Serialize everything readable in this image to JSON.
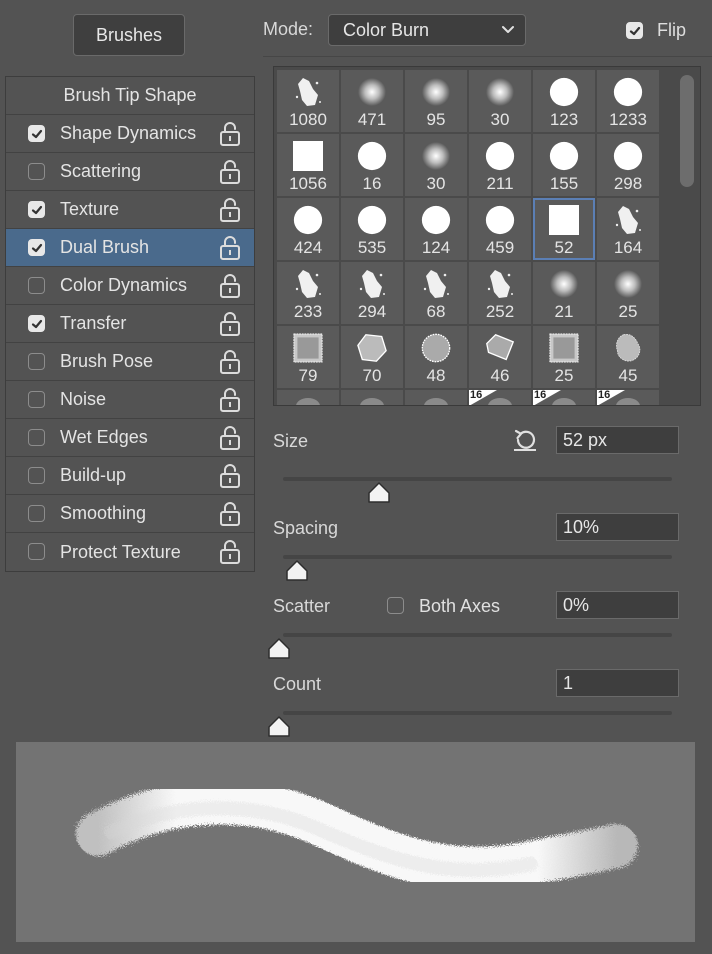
{
  "brushes_button": "Brushes",
  "mode": {
    "label": "Mode:",
    "value": "Color Burn"
  },
  "flip": {
    "label": "Flip",
    "checked": true
  },
  "left_panel": {
    "header": "Brush Tip Shape",
    "items": [
      {
        "label": "Shape Dynamics",
        "checked": true
      },
      {
        "label": "Scattering",
        "checked": false
      },
      {
        "label": "Texture",
        "checked": true
      },
      {
        "label": "Dual Brush",
        "checked": true,
        "selected": true
      },
      {
        "label": "Color Dynamics",
        "checked": false
      },
      {
        "label": "Transfer",
        "checked": true
      },
      {
        "label": "Brush Pose",
        "checked": false
      },
      {
        "label": "Noise",
        "checked": false
      },
      {
        "label": "Wet Edges",
        "checked": false
      },
      {
        "label": "Build-up",
        "checked": false
      },
      {
        "label": "Smoothing",
        "checked": false
      },
      {
        "label": "Protect Texture",
        "checked": false
      }
    ]
  },
  "brush_grid": {
    "selected": "52",
    "cells": [
      {
        "num": "1080",
        "shape": "splatter"
      },
      {
        "num": "471",
        "shape": "soft-circle"
      },
      {
        "num": "95",
        "shape": "soft-circle"
      },
      {
        "num": "30",
        "shape": "soft-circle"
      },
      {
        "num": "123",
        "shape": "hard-circle"
      },
      {
        "num": "1233",
        "shape": "hard-circle"
      },
      {
        "num": "1056",
        "shape": "square"
      },
      {
        "num": "16",
        "shape": "hard-circle"
      },
      {
        "num": "30",
        "shape": "soft-circle"
      },
      {
        "num": "211",
        "shape": "hard-circle"
      },
      {
        "num": "155",
        "shape": "hard-circle"
      },
      {
        "num": "298",
        "shape": "hard-circle"
      },
      {
        "num": "424",
        "shape": "hard-circle"
      },
      {
        "num": "535",
        "shape": "hard-circle"
      },
      {
        "num": "124",
        "shape": "hard-circle"
      },
      {
        "num": "459",
        "shape": "hard-circle"
      },
      {
        "num": "52",
        "shape": "square"
      },
      {
        "num": "164",
        "shape": "splatter"
      },
      {
        "num": "233",
        "shape": "splatter"
      },
      {
        "num": "294",
        "shape": "splatter"
      },
      {
        "num": "68",
        "shape": "splatter"
      },
      {
        "num": "252",
        "shape": "splatter"
      },
      {
        "num": "21",
        "shape": "soft-circle"
      },
      {
        "num": "25",
        "shape": "soft-circle"
      },
      {
        "num": "79",
        "shape": "texture-square"
      },
      {
        "num": "70",
        "shape": "texture-polygon"
      },
      {
        "num": "48",
        "shape": "texture-circle"
      },
      {
        "num": "46",
        "shape": "texture-diamond"
      },
      {
        "num": "25",
        "shape": "texture-square"
      },
      {
        "num": "45",
        "shape": "texture-blob"
      },
      {
        "num": "",
        "shape": "partial"
      },
      {
        "num": "",
        "shape": "partial"
      },
      {
        "num": "",
        "shape": "partial"
      },
      {
        "num": "16",
        "shape": "partial-badge"
      },
      {
        "num": "16",
        "shape": "partial-badge"
      },
      {
        "num": "16",
        "shape": "partial-badge"
      }
    ]
  },
  "size": {
    "label": "Size",
    "value": "52 px",
    "slider": 0.25
  },
  "spacing": {
    "label": "Spacing",
    "value": "10%",
    "slider": 0.03
  },
  "scatter": {
    "label": "Scatter",
    "both_axes_label": "Both Axes",
    "both_axes_checked": false,
    "value": "0%",
    "slider": 0
  },
  "count": {
    "label": "Count",
    "value": "1",
    "slider": 0
  },
  "icons": {
    "lock": "lock-icon",
    "reset": "reset-icon",
    "chevron": "chevron-down-icon",
    "check": "check-icon"
  }
}
